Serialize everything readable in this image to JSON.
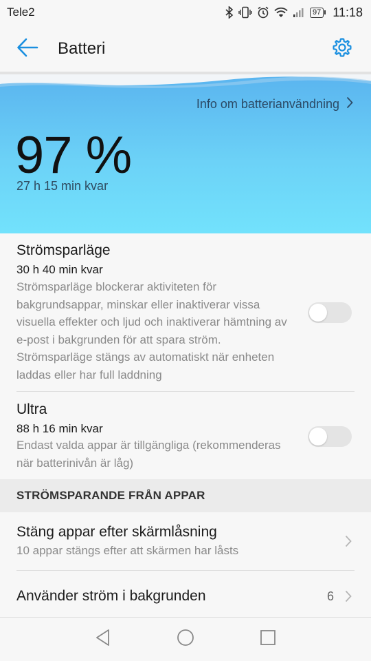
{
  "status_bar": {
    "carrier": "Tele2",
    "battery_level": "97",
    "time": "11:18",
    "icons": [
      "bluetooth-icon",
      "vibrate-icon",
      "alarm-icon",
      "wifi-icon",
      "signal-icon",
      "battery-icon"
    ]
  },
  "app_bar": {
    "title": "Batteri",
    "back_icon": "arrow-back-icon",
    "settings_icon": "gear-icon",
    "accent_color": "#1a8fe0"
  },
  "hero": {
    "info_link": "Info om batterianvändning",
    "percent": "97 %",
    "remaining": "27 h 15 min kvar",
    "gradient_top": "#5ab4ef",
    "gradient_bottom": "#72e2fc"
  },
  "power_saving": {
    "title": "Strömsparläge",
    "remaining": "30 h 40 min kvar",
    "description": "Strömsparläge blockerar aktiviteten för bakgrundsappar, minskar eller inaktiverar vissa visuella effekter och ljud och inaktiverar hämtning av e-post i bakgrunden för att spara ström. Strömsparläge stängs av automatiskt när enheten laddas eller har full laddning",
    "enabled": false
  },
  "ultra": {
    "title": "Ultra",
    "remaining": "88 h 16 min kvar",
    "description": "Endast valda appar är tillgängliga (rekommenderas när batterinivån är låg)",
    "enabled": false
  },
  "section": {
    "header": "STRÖMSPARANDE FRÅN APPAR"
  },
  "close_apps": {
    "title": "Stäng appar efter skärmlåsning",
    "subtitle": "10 appar stängs efter att skärmen har låsts"
  },
  "background_power": {
    "title": "Använder ström i bakgrunden",
    "count": "6"
  },
  "nav": {
    "back": "nav-back-icon",
    "home": "nav-home-icon",
    "recents": "nav-recents-icon"
  }
}
